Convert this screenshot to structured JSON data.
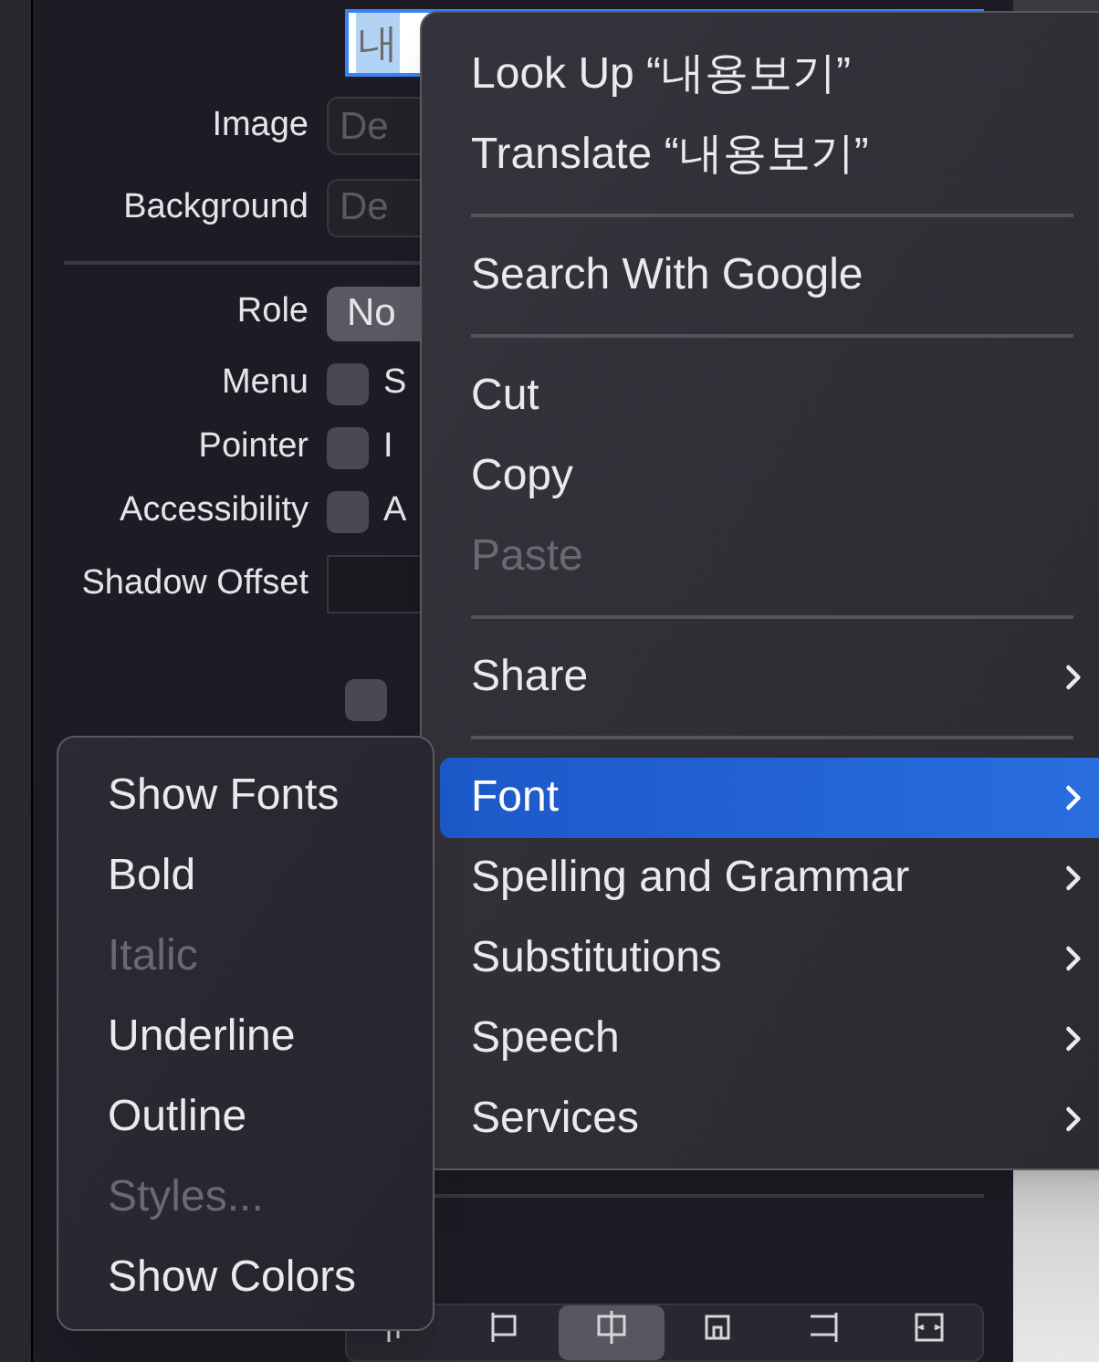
{
  "inspector": {
    "title_field": {
      "value": "내",
      "selected": true
    },
    "fields": [
      {
        "label": "Image",
        "placeholder": "De"
      },
      {
        "label": "Background",
        "placeholder": "De"
      }
    ],
    "role": {
      "label": "Role",
      "value": "No"
    },
    "checks": [
      {
        "label": "Menu",
        "option": "S",
        "checked": false
      },
      {
        "label": "Pointer",
        "option": "I",
        "checked": false
      },
      {
        "label": "Accessibility",
        "option": "A",
        "checked": false
      }
    ],
    "shadow_offset": {
      "label": "Shadow Offset"
    },
    "extra_check": {
      "checked": false
    },
    "alignment": {
      "segments": [
        {
          "selected": false
        },
        {
          "selected": false
        },
        {
          "selected": true
        },
        {
          "selected": false
        },
        {
          "selected": false
        },
        {
          "selected": false
        }
      ]
    }
  },
  "context_menu": [
    {
      "kind": "item",
      "label": "Look Up “내용보기”",
      "disabled": false,
      "submenu": false,
      "selected": false
    },
    {
      "kind": "item",
      "label": "Translate “내용보기”",
      "disabled": false,
      "submenu": false,
      "selected": false
    },
    {
      "kind": "separator"
    },
    {
      "kind": "item",
      "label": "Search With Google",
      "disabled": false,
      "submenu": false,
      "selected": false
    },
    {
      "kind": "separator"
    },
    {
      "kind": "item",
      "label": "Cut",
      "disabled": false,
      "submenu": false,
      "selected": false
    },
    {
      "kind": "item",
      "label": "Copy",
      "disabled": false,
      "submenu": false,
      "selected": false
    },
    {
      "kind": "item",
      "label": "Paste",
      "disabled": true,
      "submenu": false,
      "selected": false
    },
    {
      "kind": "separator"
    },
    {
      "kind": "item",
      "label": "Share",
      "disabled": false,
      "submenu": true,
      "selected": false
    },
    {
      "kind": "separator"
    },
    {
      "kind": "item",
      "label": "Font",
      "disabled": false,
      "submenu": true,
      "selected": true
    },
    {
      "kind": "item",
      "label": "Spelling and Grammar",
      "disabled": false,
      "submenu": true,
      "selected": false
    },
    {
      "kind": "item",
      "label": "Substitutions",
      "disabled": false,
      "submenu": true,
      "selected": false
    },
    {
      "kind": "item",
      "label": "Speech",
      "disabled": false,
      "submenu": true,
      "selected": false
    },
    {
      "kind": "item",
      "label": "Services",
      "disabled": false,
      "submenu": true,
      "selected": false
    }
  ],
  "font_submenu": [
    {
      "label": "Show Fonts",
      "disabled": false
    },
    {
      "label": "Bold",
      "disabled": false
    },
    {
      "label": "Italic",
      "disabled": true
    },
    {
      "label": "Underline",
      "disabled": false
    },
    {
      "label": "Outline",
      "disabled": false
    },
    {
      "label": "Styles...",
      "disabled": true
    },
    {
      "label": "Show Colors",
      "disabled": false
    }
  ]
}
